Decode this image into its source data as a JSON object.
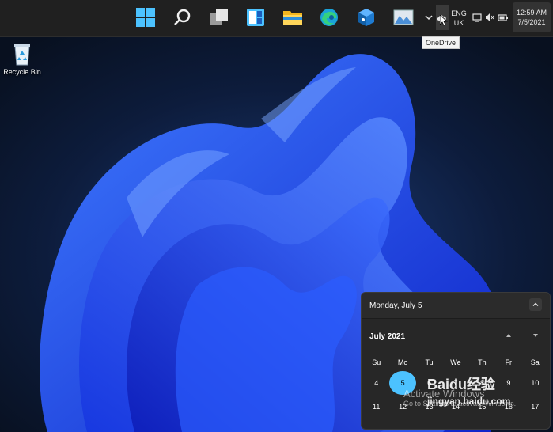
{
  "tray": {
    "language_top": "ENG",
    "language_bottom": "UK",
    "time": "12:59 AM",
    "date": "7/5/2021",
    "tooltip": "OneDrive"
  },
  "desktop": {
    "recycle_bin_label": "Recycle Bin"
  },
  "calendar": {
    "header_date": "Monday, July 5",
    "month_label": "July 2021",
    "weekdays": [
      "Su",
      "Mo",
      "Tu",
      "We",
      "Th",
      "Fr",
      "Sa"
    ],
    "week1": [
      "4",
      "5",
      "6",
      "7",
      "8",
      "9",
      "10"
    ],
    "week2": [
      "11",
      "12",
      "13",
      "14",
      "15",
      "16",
      "17"
    ],
    "today": "5"
  },
  "watermark": {
    "activate_line1": "Activate Windows",
    "activate_line2": "Go to Settings to activate Windows.",
    "baidu_logo": "Baidu经验",
    "baidu_url": "jingyan.baidu.com"
  },
  "colors": {
    "taskbar": "#202020",
    "accent": "#4cc2ff",
    "wallpaper_blue": "#1a3cff"
  }
}
